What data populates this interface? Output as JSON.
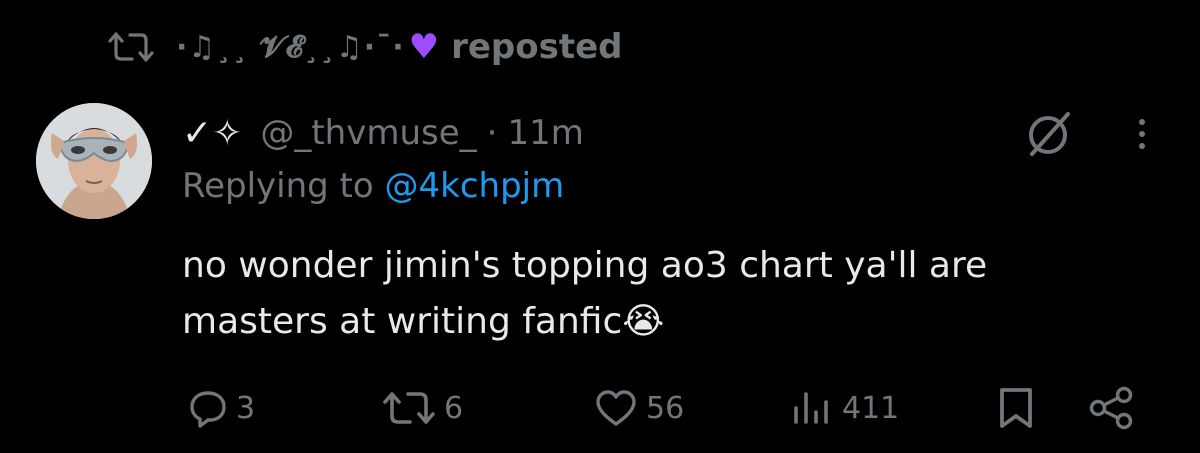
{
  "repost": {
    "user": "·♫¸¸ 𝓥𝓔¸¸♫·¯·",
    "label": "reposted"
  },
  "tweet": {
    "name": "✓✧",
    "handle": "@_thvmuse_",
    "separator": "·",
    "time": "11m",
    "replying_prefix": "Replying to ",
    "replying_handle": "@4kchpjm",
    "text_line1": "no wonder jimin's topping ao3 chart ya'll are",
    "text_line2": "masters at writing fanfic",
    "emoji": "😭"
  },
  "actions": {
    "replies": "3",
    "reposts": "6",
    "likes": "56",
    "views": "411"
  },
  "colors": {
    "background": "#000000",
    "text": "#e7e9ea",
    "muted": "#71767b",
    "link": "#1d9bf0",
    "heart": "#9d4dff"
  },
  "icons": [
    "repost-icon",
    "purple-heart-icon",
    "grok-icon",
    "more-icon",
    "reply-icon",
    "retweet-icon",
    "like-icon",
    "views-icon",
    "bookmark-icon",
    "share-icon"
  ]
}
